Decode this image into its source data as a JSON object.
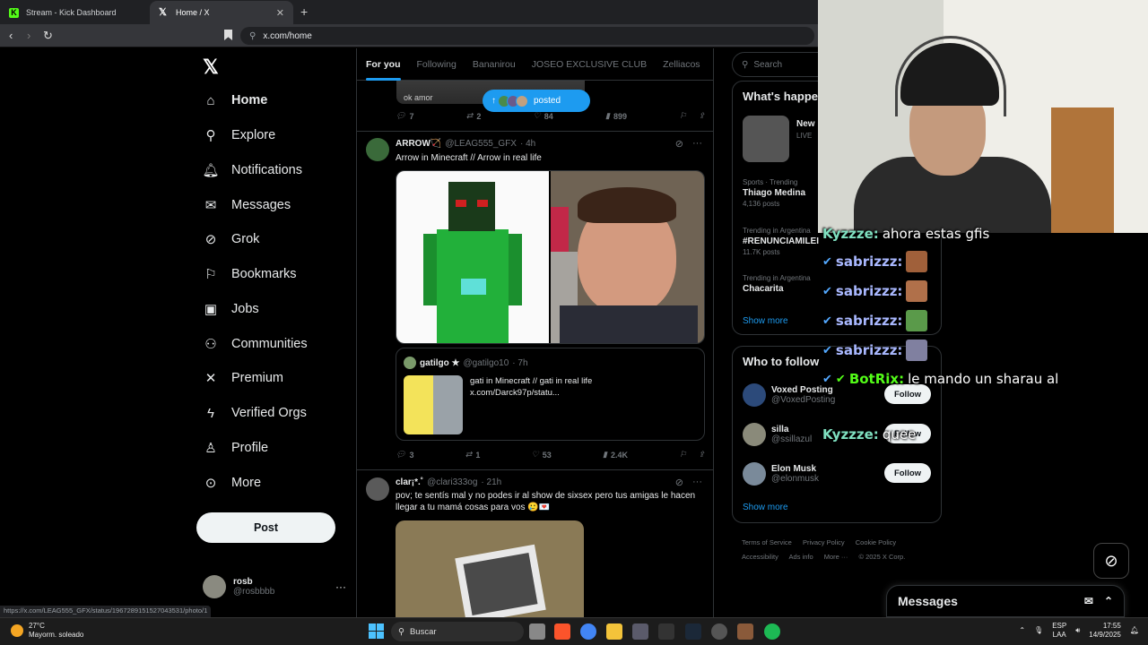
{
  "browser": {
    "tabs": [
      {
        "title": "Stream - Kick Dashboard",
        "active": false
      },
      {
        "title": "Home / X",
        "active": true
      }
    ],
    "url": "x.com/home",
    "status_url": "https://x.com/LEAG555_GFX/status/1967289151527043531/photo/1"
  },
  "nav": {
    "items": [
      {
        "label": "Home",
        "icon": "home-icon"
      },
      {
        "label": "Explore",
        "icon": "search-icon"
      },
      {
        "label": "Notifications",
        "icon": "bell-icon"
      },
      {
        "label": "Messages",
        "icon": "envelope-icon"
      },
      {
        "label": "Grok",
        "icon": "grok-icon"
      },
      {
        "label": "Bookmarks",
        "icon": "bookmark-icon"
      },
      {
        "label": "Jobs",
        "icon": "briefcase-icon"
      },
      {
        "label": "Communities",
        "icon": "people-icon"
      },
      {
        "label": "Premium",
        "icon": "x-logo-icon"
      },
      {
        "label": "Verified Orgs",
        "icon": "lightning-icon"
      },
      {
        "label": "Profile",
        "icon": "person-icon"
      },
      {
        "label": "More",
        "icon": "more-circle-icon"
      }
    ],
    "post_label": "Post",
    "account": {
      "name": "rosb",
      "handle": "@rosbbbb"
    }
  },
  "timeline": {
    "tabs": [
      "For you",
      "Following",
      "Bananirou",
      "JOSEO EXCLUSIVE CLUB",
      "Zelliacos"
    ],
    "posted_pill": "posted",
    "prev_post": {
      "caption": "ok amor",
      "replies": "7",
      "reposts": "2",
      "likes": "84",
      "views": "899"
    },
    "tweet1": {
      "name": "ARROW🏹",
      "handle": "@LEAG555_GFX",
      "time": "· 4h",
      "text": "Arrow in Minecraft // Arrow in real life",
      "quote": {
        "name": "gatilgo ★",
        "handle": "@gatilgo10",
        "time": "· 7h",
        "line1": "gati in Minecraft // gati in real life",
        "line2": "x.com/Darck97p/statu..."
      },
      "replies": "3",
      "reposts": "1",
      "likes": "53",
      "views": "2.4K"
    },
    "tweet2": {
      "name": "clar¡*.˚",
      "handle": "@clari333og",
      "time": "· 21h",
      "text": "pov; te sentís mal y no podes ir al show de sixsex pero tus amigas le hacen llegar a tu mamá cosas para vos 🥲💌"
    }
  },
  "right": {
    "search_placeholder": "Search",
    "whats_happening": "What's happening",
    "live": {
      "title": "New",
      "badge": "LIVE"
    },
    "trends": [
      {
        "context": "Sports · Trending",
        "name": "Thiago Medina",
        "posts": "4,136 posts"
      },
      {
        "context": "Trending in Argentina",
        "name": "#RENUNCIAMILEI",
        "posts": "11.7K posts"
      },
      {
        "context": "Trending in Argentina",
        "name": "Chacarita",
        "posts": ""
      }
    ],
    "show_more": "Show more",
    "who_to_follow": "Who to follow",
    "follow": [
      {
        "name": "Voxed Posting",
        "handle": "@VoxedPosting",
        "btn": "Follow"
      },
      {
        "name": "silla",
        "handle": "@ssillazul",
        "btn": "Follow"
      },
      {
        "name": "Elon Musk",
        "handle": "@elonmusk",
        "btn": "Follow"
      }
    ],
    "footer": [
      "Terms of Service",
      "Privacy Policy",
      "Cookie Policy",
      "Accessibility",
      "Ads info",
      "More ···",
      "© 2025 X Corp."
    ]
  },
  "chat": [
    {
      "user": "Kyzzze:",
      "msg": "ahora estas gfis",
      "emote": ""
    },
    {
      "user": "sabrizzz:",
      "msg": "",
      "emote": "#a0603a"
    },
    {
      "user": "sabrizzz:",
      "msg": "",
      "emote": "#b0704a"
    },
    {
      "user": "sabrizzz:",
      "msg": "",
      "emote": "#5a9a4a"
    },
    {
      "user": "sabrizzz:",
      "msg": "",
      "emote": "#8080a0"
    },
    {
      "user": "BotRix:",
      "msg": "le mando un sharau al",
      "emote": ""
    },
    {
      "user": "Kyzzze:",
      "msg": "quee",
      "emote": ""
    }
  ],
  "messages_drawer": "Messages",
  "taskbar": {
    "temp": "27°C",
    "weather": "Mayorm. soleado",
    "search": "Buscar",
    "lang1": "ESP",
    "lang2": "LAA",
    "time": "17:55",
    "date": "14/9/2025"
  },
  "colors": {
    "accent": "#1d9bf0",
    "kick_green": "#53fc18",
    "border": "#2f3336"
  }
}
